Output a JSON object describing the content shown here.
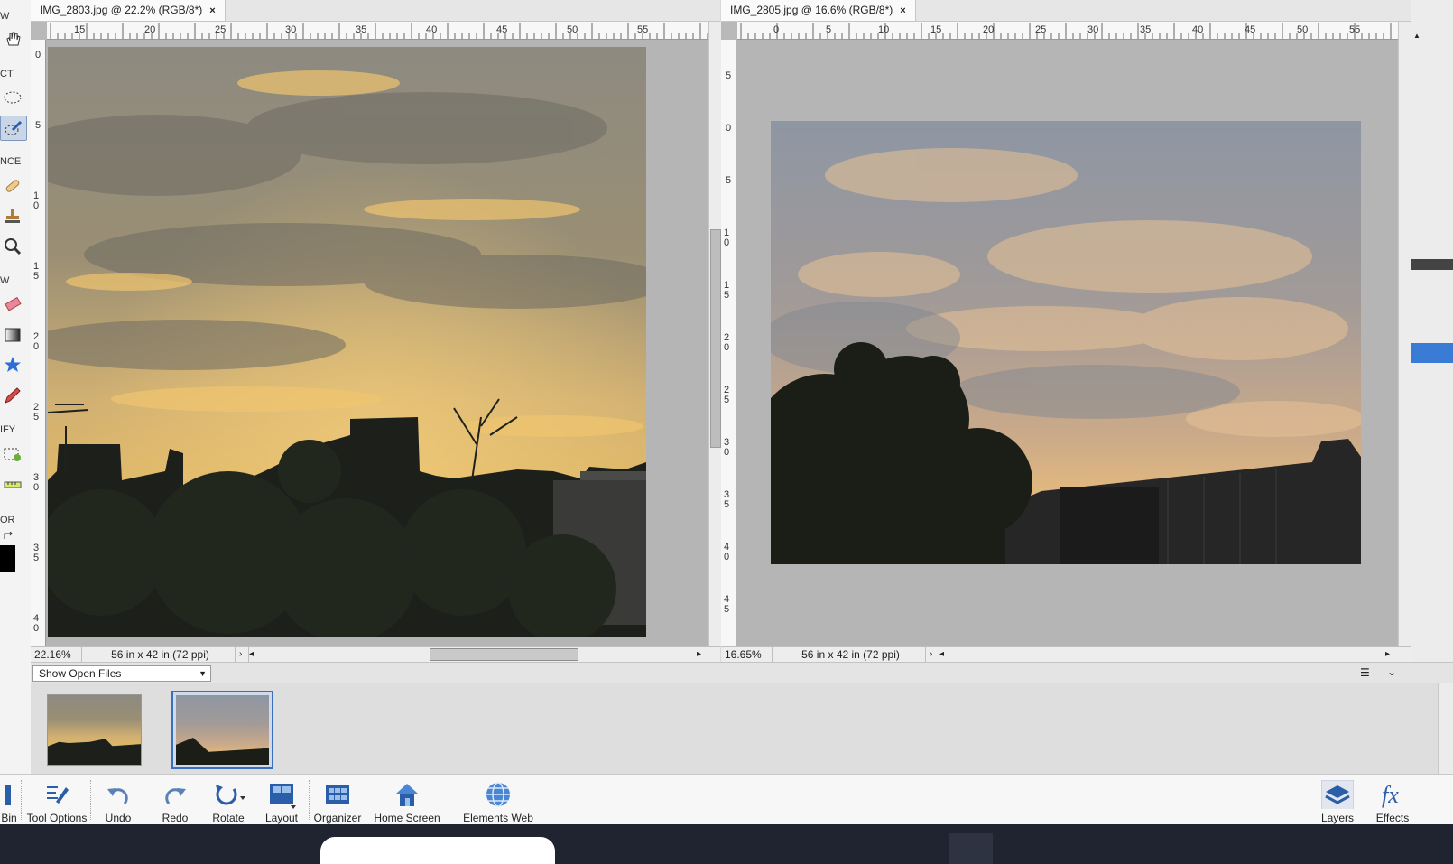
{
  "toolbox": {
    "sections": [
      "W",
      "CT",
      "NCE",
      "W",
      "IFY",
      "OR"
    ]
  },
  "doc_left": {
    "tab_title": "IMG_2803.jpg @ 22.2% (RGB/8*)",
    "close": "×",
    "ruler_h": [
      "15",
      "20",
      "25",
      "30",
      "35",
      "40",
      "45",
      "50",
      "55"
    ],
    "ruler_v": [
      "0",
      "5",
      "1 0",
      "1 5",
      "2 0",
      "2 5",
      "3 0",
      "3 5",
      "4 0"
    ],
    "zoom": "22.16%",
    "doc_size": "56 in x 42 in (72 ppi)"
  },
  "doc_right": {
    "tab_title": "IMG_2805.jpg @ 16.6% (RGB/8*)",
    "close": "×",
    "ruler_h": [
      "0",
      "5",
      "10",
      "15",
      "20",
      "25",
      "30",
      "35",
      "40",
      "45",
      "50",
      "55"
    ],
    "ruler_v": [
      "5",
      "0",
      "5",
      "1 0",
      "1 5",
      "2 0",
      "2 5",
      "3 0",
      "3 5",
      "4 0",
      "4 5"
    ],
    "zoom": "16.65%",
    "doc_size": "56 in x 42 in (72 ppi)"
  },
  "photo_bin": {
    "dropdown": "Show Open Files"
  },
  "taskbar": {
    "bin": "Bin",
    "tool_options": "Tool Options",
    "undo": "Undo",
    "redo": "Redo",
    "rotate": "Rotate",
    "layout": "Layout",
    "organizer": "Organizer",
    "home_screen": "Home Screen",
    "elements_web": "Elements Web",
    "layers": "Layers",
    "effects": "Effects"
  },
  "colors": {
    "accent": "#3a6fbf",
    "sky_gold": "#d9ad5e",
    "sky_gray": "#8c8a84",
    "silhouette": "#1c1f1a"
  }
}
